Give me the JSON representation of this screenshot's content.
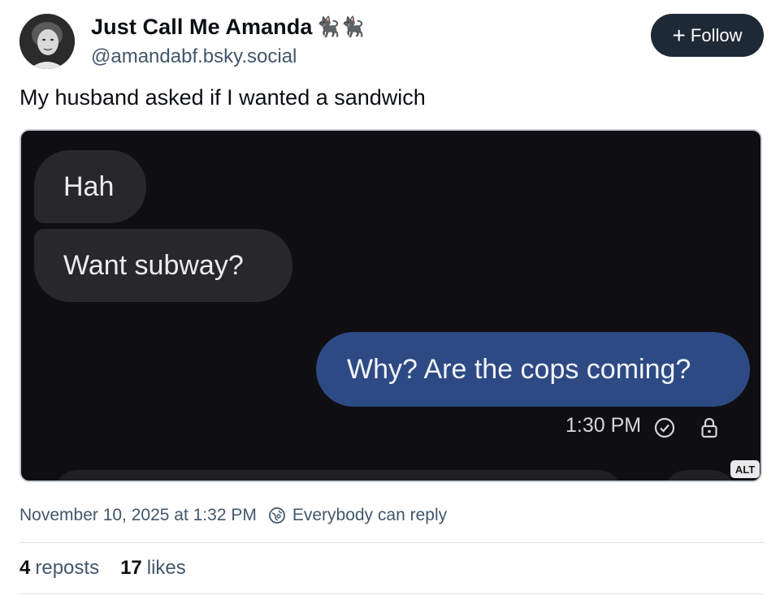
{
  "author": {
    "display_name": "Just Call Me Amanda",
    "name_emoji": "🐈‍⬛🐈‍⬛",
    "handle": "@amandabf.bsky.social"
  },
  "follow_button": {
    "label": "Follow"
  },
  "post": {
    "text": "My husband asked if I wanted a sandwich",
    "timestamp": "November 10, 2025 at 1:32 PM",
    "reply_setting": "Everybody can reply"
  },
  "media": {
    "alt_badge": "ALT",
    "messages": [
      {
        "side": "incoming",
        "text": "Hah"
      },
      {
        "side": "incoming",
        "text": "Want subway?"
      },
      {
        "side": "outgoing",
        "text": "Why? Are the cops coming?"
      }
    ],
    "message_time": "1:30 PM"
  },
  "stats": {
    "reposts_count": "4",
    "reposts_label": "reposts",
    "likes_count": "17",
    "likes_label": "likes"
  },
  "colors": {
    "follow_bg": "#1e2936",
    "outgoing_bubble": "#2e4a84",
    "incoming_bubble": "#27272c",
    "muted_text": "#42576c"
  }
}
